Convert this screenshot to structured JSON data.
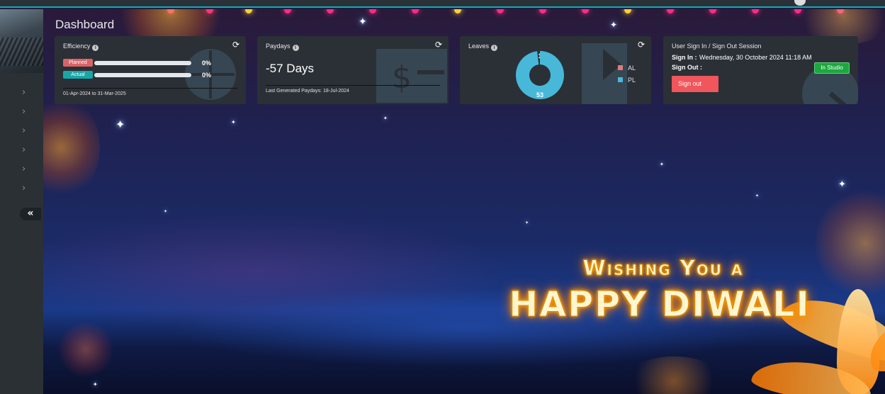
{
  "page": {
    "title": "Dashboard"
  },
  "sidebar": {
    "collapse_icon": "«",
    "items": [
      "›",
      "›",
      "›",
      "›",
      "›",
      "›"
    ]
  },
  "efficiency": {
    "title": "Efficiency",
    "planned_label": "Planned",
    "actual_label": "Actual",
    "planned_pct": "0%",
    "actual_pct": "0%",
    "planned_value": 0,
    "actual_value": 0,
    "period": "01-Apr-2024 to 31-Mar-2025",
    "colors": {
      "planned": "#d9636a",
      "actual": "#17a7a9"
    }
  },
  "paydays": {
    "title": "Paydays",
    "value": "-57 Days",
    "last_generated": "Last Generated Paydays: 18-Jul-2024"
  },
  "leaves": {
    "title": "Leaves",
    "legend": [
      {
        "label": "AL",
        "color": "#e07a84"
      },
      {
        "label": "PL",
        "color": "#48b8d9"
      }
    ],
    "chart_data": {
      "type": "pie",
      "categories": [
        "AL",
        "PL"
      ],
      "values": [
        1,
        53
      ]
    }
  },
  "session": {
    "title": "User Sign In / Sign Out Session",
    "sign_in_label": "Sign In :",
    "sign_in_value": "Wednesday, 30 October 2024 11:18 AM",
    "sign_out_label": "Sign Out :",
    "sign_out_value": "",
    "sign_out_button": "Sign out",
    "status_badge": "In Studio",
    "colors": {
      "button": "#f0565b",
      "badge": "#1da73f"
    }
  },
  "greeting": {
    "line1": "Wishing You a",
    "line2": "HAPPY DIWALI"
  },
  "icons": {
    "info": "i",
    "refresh": "⟳"
  }
}
